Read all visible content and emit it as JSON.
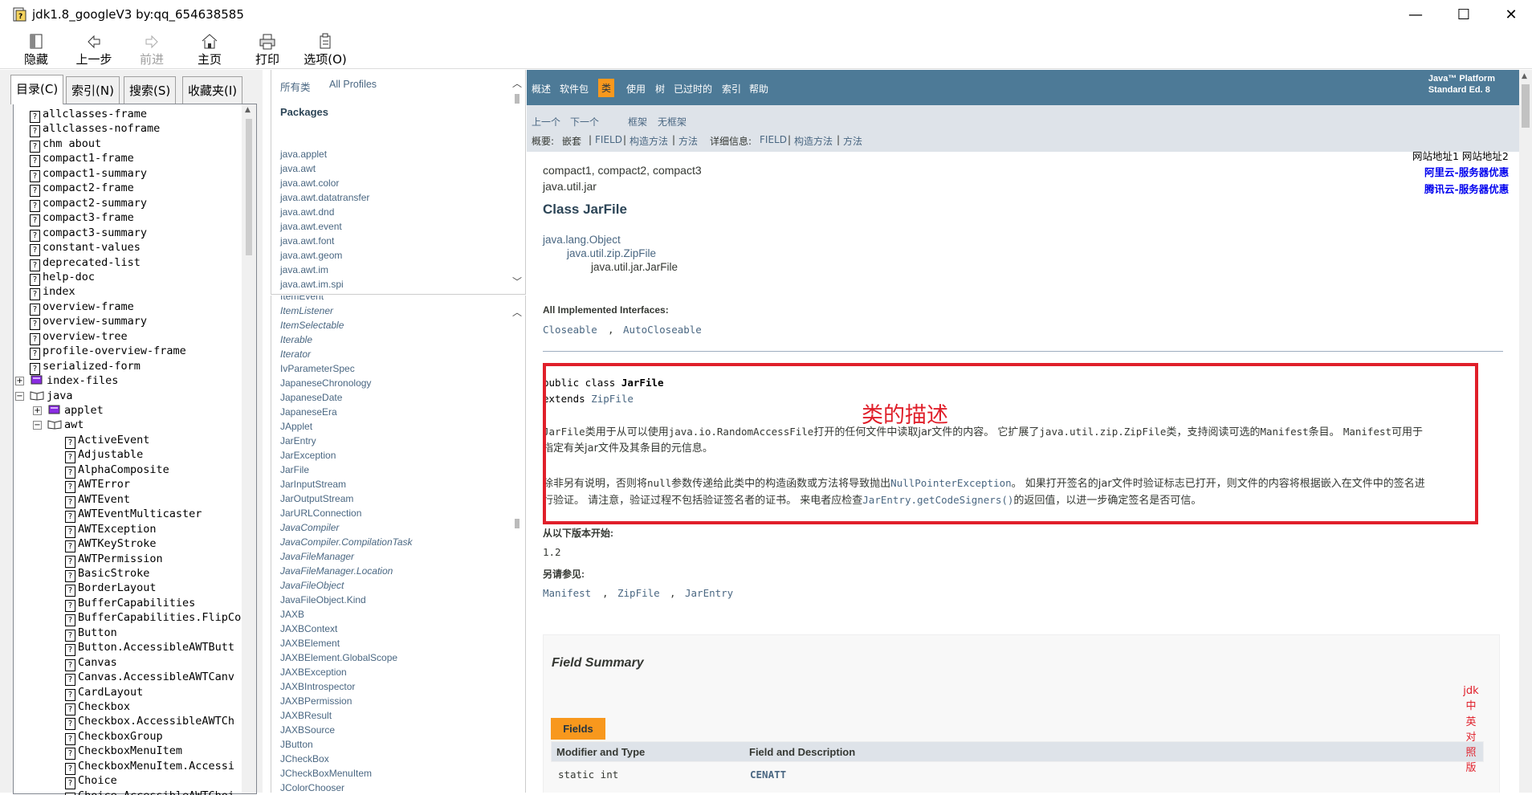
{
  "window": {
    "title": "jdk1.8_googleV3 by:qq_654638585",
    "controls": [
      "—",
      "☐",
      "✕"
    ]
  },
  "toolbar": {
    "buttons": [
      {
        "label": "隐藏",
        "icon": "hide-icon"
      },
      {
        "label": "上一步",
        "icon": "back-arrow-icon"
      },
      {
        "label": "前进",
        "icon": "forward-arrow-icon",
        "disabled": true
      },
      {
        "label": "主页",
        "icon": "home-icon"
      },
      {
        "label": "打印",
        "icon": "print-icon"
      },
      {
        "label": "选项(O)",
        "icon": "options-icon"
      }
    ]
  },
  "nav": {
    "tabs": [
      "目录(C)",
      "索引(N)",
      "搜索(S)",
      "收藏夹(I)"
    ],
    "active_tab": "目录(C)",
    "tree": [
      {
        "label": "allclasses-frame",
        "level": 1,
        "icon": "help-page-icon"
      },
      {
        "label": "allclasses-noframe",
        "level": 1,
        "icon": "help-page-icon"
      },
      {
        "label": "chm about",
        "level": 1,
        "icon": "help-page-icon"
      },
      {
        "label": "compact1-frame",
        "level": 1,
        "icon": "help-page-icon"
      },
      {
        "label": "compact1-summary",
        "level": 1,
        "icon": "help-page-icon"
      },
      {
        "label": "compact2-frame",
        "level": 1,
        "icon": "help-page-icon"
      },
      {
        "label": "compact2-summary",
        "level": 1,
        "icon": "help-page-icon"
      },
      {
        "label": "compact3-frame",
        "level": 1,
        "icon": "help-page-icon"
      },
      {
        "label": "compact3-summary",
        "level": 1,
        "icon": "help-page-icon"
      },
      {
        "label": "constant-values",
        "level": 1,
        "icon": "help-page-icon"
      },
      {
        "label": "deprecated-list",
        "level": 1,
        "icon": "help-page-icon"
      },
      {
        "label": "help-doc",
        "level": 1,
        "icon": "help-page-icon"
      },
      {
        "label": "index",
        "level": 1,
        "icon": "help-page-icon"
      },
      {
        "label": "overview-frame",
        "level": 1,
        "icon": "help-page-icon"
      },
      {
        "label": "overview-summary",
        "level": 1,
        "icon": "help-page-icon"
      },
      {
        "label": "overview-tree",
        "level": 1,
        "icon": "help-page-icon"
      },
      {
        "label": "profile-overview-frame",
        "level": 1,
        "icon": "help-page-icon"
      },
      {
        "label": "serialized-form",
        "level": 1,
        "icon": "help-page-icon"
      },
      {
        "label": "index-files",
        "level": 0,
        "icon": "closed-book-icon",
        "expander": "+"
      },
      {
        "label": "java",
        "level": 0,
        "icon": "open-book-icon",
        "expander": "−"
      },
      {
        "label": "applet",
        "level": 1,
        "icon": "closed-book-icon",
        "expander": "+"
      },
      {
        "label": "awt",
        "level": 1,
        "icon": "open-book-icon",
        "expander": "−"
      },
      {
        "label": "ActiveEvent",
        "level": 2,
        "icon": "help-page-icon"
      },
      {
        "label": "Adjustable",
        "level": 2,
        "icon": "help-page-icon"
      },
      {
        "label": "AlphaComposite",
        "level": 2,
        "icon": "help-page-icon"
      },
      {
        "label": "AWTError",
        "level": 2,
        "icon": "help-page-icon"
      },
      {
        "label": "AWTEvent",
        "level": 2,
        "icon": "help-page-icon"
      },
      {
        "label": "AWTEventMulticaster",
        "level": 2,
        "icon": "help-page-icon"
      },
      {
        "label": "AWTException",
        "level": 2,
        "icon": "help-page-icon"
      },
      {
        "label": "AWTKeyStroke",
        "level": 2,
        "icon": "help-page-icon"
      },
      {
        "label": "AWTPermission",
        "level": 2,
        "icon": "help-page-icon"
      },
      {
        "label": "BasicStroke",
        "level": 2,
        "icon": "help-page-icon"
      },
      {
        "label": "BorderLayout",
        "level": 2,
        "icon": "help-page-icon"
      },
      {
        "label": "BufferCapabilities",
        "level": 2,
        "icon": "help-page-icon"
      },
      {
        "label": "BufferCapabilities.FlipCo",
        "level": 2,
        "icon": "help-page-icon"
      },
      {
        "label": "Button",
        "level": 2,
        "icon": "help-page-icon"
      },
      {
        "label": "Button.AccessibleAWTButt",
        "level": 2,
        "icon": "help-page-icon"
      },
      {
        "label": "Canvas",
        "level": 2,
        "icon": "help-page-icon"
      },
      {
        "label": "Canvas.AccessibleAWTCanv",
        "level": 2,
        "icon": "help-page-icon"
      },
      {
        "label": "CardLayout",
        "level": 2,
        "icon": "help-page-icon"
      },
      {
        "label": "Checkbox",
        "level": 2,
        "icon": "help-page-icon"
      },
      {
        "label": "Checkbox.AccessibleAWTCh",
        "level": 2,
        "icon": "help-page-icon"
      },
      {
        "label": "CheckboxGroup",
        "level": 2,
        "icon": "help-page-icon"
      },
      {
        "label": "CheckboxMenuItem",
        "level": 2,
        "icon": "help-page-icon"
      },
      {
        "label": "CheckboxMenuItem.Accessi",
        "level": 2,
        "icon": "help-page-icon"
      },
      {
        "label": "Choice",
        "level": 2,
        "icon": "help-page-icon"
      },
      {
        "label": "Choice.AccessibleAWTChoi",
        "level": 2,
        "icon": "help-page-icon"
      }
    ]
  },
  "packages_frame": {
    "top_links": [
      "所有类",
      "All Profiles"
    ],
    "heading": "Packages",
    "packages": [
      "java.applet",
      "java.awt",
      "java.awt.color",
      "java.awt.datatransfer",
      "java.awt.dnd",
      "java.awt.event",
      "java.awt.font",
      "java.awt.geom",
      "java.awt.im",
      "java.awt.im.spi"
    ]
  },
  "classes_frame": {
    "classes": [
      {
        "name": "ItemEvent",
        "italic": false
      },
      {
        "name": "ItemListener",
        "italic": true
      },
      {
        "name": "ItemSelectable",
        "italic": true
      },
      {
        "name": "Iterable",
        "italic": true
      },
      {
        "name": "Iterator",
        "italic": true
      },
      {
        "name": "IvParameterSpec",
        "italic": false
      },
      {
        "name": "JapaneseChronology",
        "italic": false
      },
      {
        "name": "JapaneseDate",
        "italic": false
      },
      {
        "name": "JapaneseEra",
        "italic": false
      },
      {
        "name": "JApplet",
        "italic": false
      },
      {
        "name": "JarEntry",
        "italic": false
      },
      {
        "name": "JarException",
        "italic": false
      },
      {
        "name": "JarFile",
        "italic": false
      },
      {
        "name": "JarInputStream",
        "italic": false
      },
      {
        "name": "JarOutputStream",
        "italic": false
      },
      {
        "name": "JarURLConnection",
        "italic": false
      },
      {
        "name": "JavaCompiler",
        "italic": true
      },
      {
        "name": "JavaCompiler.CompilationTask",
        "italic": true
      },
      {
        "name": "JavaFileManager",
        "italic": true
      },
      {
        "name": "JavaFileManager.Location",
        "italic": true
      },
      {
        "name": "JavaFileObject",
        "italic": true
      },
      {
        "name": "JavaFileObject.Kind",
        "italic": false
      },
      {
        "name": "JAXB",
        "italic": false
      },
      {
        "name": "JAXBContext",
        "italic": false
      },
      {
        "name": "JAXBElement",
        "italic": false
      },
      {
        "name": "JAXBElement.GlobalScope",
        "italic": false
      },
      {
        "name": "JAXBException",
        "italic": false
      },
      {
        "name": "JAXBIntrospector",
        "italic": false
      },
      {
        "name": "JAXBPermission",
        "italic": false
      },
      {
        "name": "JAXBResult",
        "italic": false
      },
      {
        "name": "JAXBSource",
        "italic": false
      },
      {
        "name": "JButton",
        "italic": false
      },
      {
        "name": "JCheckBox",
        "italic": false
      },
      {
        "name": "JCheckBoxMenuItem",
        "italic": false
      },
      {
        "name": "JColorChooser",
        "italic": false
      }
    ]
  },
  "doc": {
    "topnav": [
      "概述",
      "软件包",
      "类",
      "使用",
      "树",
      "已过时的",
      "索引",
      "帮助"
    ],
    "topnav_active": "类",
    "platform_line1": "Java™ Platform",
    "platform_line2": "Standard Ed. 8",
    "subnav_row1": [
      "上一个",
      "下一个",
      "框架",
      "无框架"
    ],
    "summary_label": "概要:",
    "summary_items": [
      "嵌套",
      "|",
      "FIELD",
      "|",
      "构造方法",
      "|",
      "方法"
    ],
    "detail_label": "详细信息:",
    "detail_items": [
      "FIELD",
      "|",
      "构造方法",
      "|",
      "方法"
    ],
    "profiles": "compact1, compact2, compact3",
    "package": "java.util.jar",
    "class_title": "Class JarFile",
    "hierarchy": [
      "java.lang.Object",
      "java.util.zip.ZipFile",
      "java.util.jar.JarFile"
    ],
    "interfaces_label": "All Implemented Interfaces:",
    "interfaces": [
      "Closeable",
      ",",
      "AutoCloseable"
    ],
    "decl_line1_pre": "public class ",
    "decl_line1_name": "JarFile",
    "decl_line2_pre": "extends ",
    "decl_line2_link": "ZipFile",
    "annotation": "类的描述",
    "desc_p1_parts": [
      "JarFile",
      "类用于从可以使用",
      "java.io.RandomAccessFile",
      "打开的任何文件中读取jar文件的内容。 它扩展了",
      "java.util.zip.ZipFile",
      "类，支持阅读可选的",
      "Manifest",
      "条目。 ",
      "Manifest",
      "可用于"
    ],
    "desc_p1_line2": "指定有关jar文件及其条目的元信息。",
    "desc_p2_parts": [
      "除非另有说明，否则将",
      "null",
      "参数传递给此类中的构造函数或方法将导致抛出",
      "NullPointerException",
      "。 如果打开签名的jar文件时验证标志已打开，则文件的内容将根据嵌入在文件中的签名进"
    ],
    "desc_p2_line2_parts": [
      "行验证。 请注意，验证过程不包括验证签名者的证书。 来电者应检查",
      "JarEntry.getCodeSigners()",
      "的返回值，以进一步确定签名是否可信。"
    ],
    "since_label": "从以下版本开始:",
    "since_value": "1.2",
    "see_label": "另请参见:",
    "see_items": [
      "Manifest",
      ",",
      "ZipFile",
      ",",
      "JarEntry"
    ],
    "field_summary_title": "Field Summary",
    "fields_tab": "Fields",
    "table_headers": [
      "Modifier and Type",
      "Field and Description"
    ],
    "first_row": [
      "static int",
      "CENATT"
    ]
  },
  "side_ads": {
    "sites": "网站地址1 网站地址2",
    "aliyun": "阿里云-服务器优惠",
    "tencent": "腾讯云-服务器优惠",
    "vertical_note": [
      "jdk",
      "中",
      "英",
      "对",
      "照",
      "版"
    ]
  },
  "colors": {
    "navbar_blue": "#4d7a97",
    "active_orange": "#f8981d",
    "subnav_gray": "#dee3e9",
    "link_blue": "#4a6782",
    "annotation_red": "#e01f2a"
  }
}
